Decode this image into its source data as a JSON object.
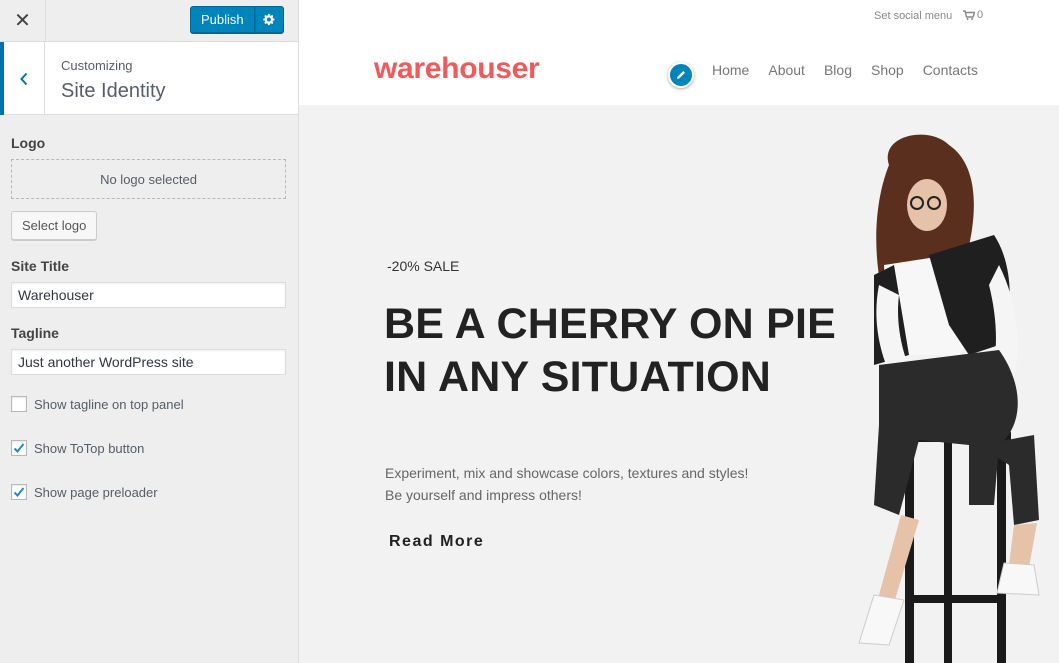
{
  "sidebar": {
    "close_icon": "close-icon",
    "publish_label": "Publish",
    "gear_icon": "gear-icon",
    "customizing_label": "Customizing",
    "section_title": "Site Identity",
    "logo": {
      "label": "Logo",
      "empty_text": "No logo selected",
      "select_button": "Select logo"
    },
    "site_title": {
      "label": "Site Title",
      "value": "Warehouser"
    },
    "tagline": {
      "label": "Tagline",
      "value": "Just another WordPress site"
    },
    "checkboxes": [
      {
        "label": "Show tagline on top panel",
        "checked": false
      },
      {
        "label": "Show ToTop button",
        "checked": true
      },
      {
        "label": "Show page preloader",
        "checked": true
      }
    ],
    "accent_color": "#0073aa",
    "button_color": "#0085ba"
  },
  "preview": {
    "social_menu": "Set social menu",
    "cart_count": "0",
    "logo_text": "warehouser",
    "logo_color": "#f05a5a",
    "nav": [
      "Home",
      "About",
      "Blog",
      "Shop",
      "Contacts"
    ],
    "hero": {
      "sale": "-20% SALE",
      "headline_1": "BE A CHERRY ON PIE",
      "headline_2": "IN ANY SITUATION",
      "desc_1": "Experiment, mix and showcase colors, textures and styles!",
      "desc_2": "Be yourself and impress others!",
      "cta": "Read More"
    }
  }
}
